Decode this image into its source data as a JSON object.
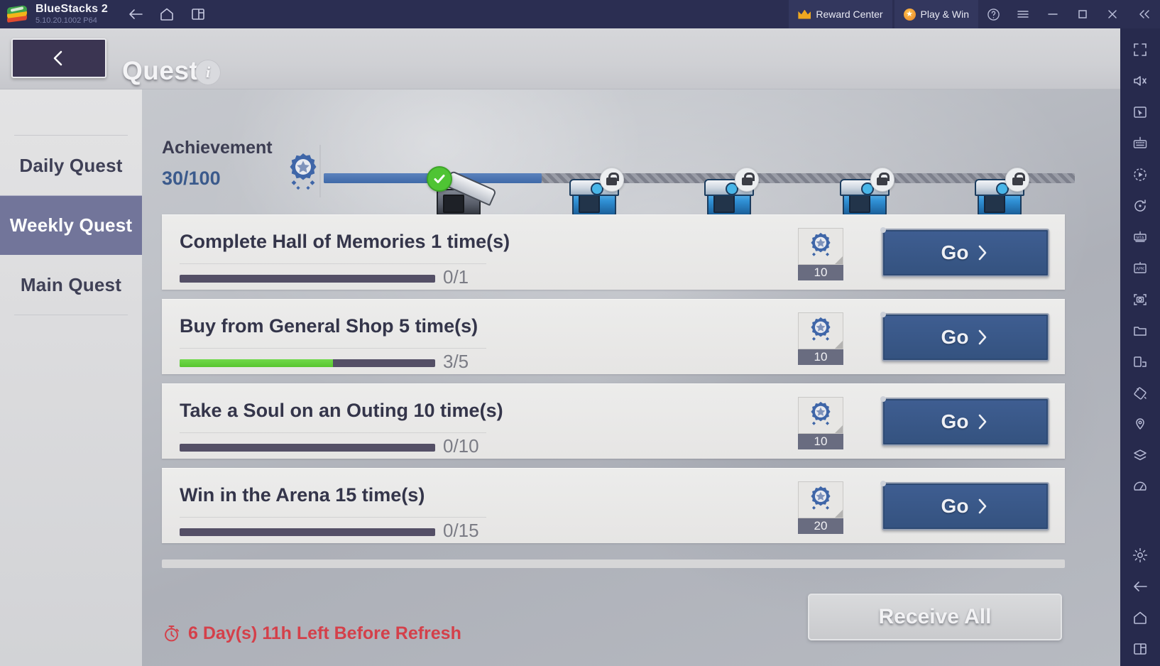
{
  "titlebar": {
    "app_name": "BlueStacks 2",
    "version": "5.10.20.1002  P64",
    "nav": [
      {
        "name": "back-arrow-icon",
        "label": "Back"
      },
      {
        "name": "home-icon",
        "label": "Home"
      },
      {
        "name": "multi-instance-icon",
        "label": "Instances"
      }
    ],
    "reward_center": "Reward Center",
    "play_and_win": "Play & Win",
    "window_buttons": [
      "help-icon",
      "menu-icon",
      "minimize-icon",
      "maximize-icon",
      "close-icon",
      "collapse-icon"
    ]
  },
  "right_toolbar": {
    "icons": [
      "fullscreen-icon",
      "mute-icon",
      "cursor-icon",
      "keyboard-controls-icon",
      "macro-play-icon",
      "rotate-icon",
      "game-controls-icon",
      "apk-install-icon",
      "screenshot-icon",
      "media-folder-icon",
      "multi-instance-sync-icon",
      "tilt-icon",
      "location-icon",
      "layers-icon",
      "performance-meter-icon"
    ],
    "bottom_icons": [
      "settings-gear-icon",
      "android-back-icon",
      "android-home-icon",
      "android-recents-icon"
    ]
  },
  "game": {
    "header": {
      "back_label": "Back",
      "title": "Quest",
      "info_label": "i"
    },
    "quest_tabs": [
      {
        "label": "Daily Quest",
        "active": false
      },
      {
        "label": "Weekly Quest",
        "active": true
      },
      {
        "label": "Main Quest",
        "active": false
      }
    ],
    "achievement": {
      "label": "Achievement",
      "count": "30/100",
      "current": 30,
      "max": 100,
      "fill_percent": 29,
      "milestones": [
        {
          "value": "20",
          "position_percent": 18,
          "state": "claimed"
        },
        {
          "value": "40",
          "position_percent": 36,
          "state": "locked"
        },
        {
          "value": "60",
          "position_percent": 54,
          "state": "locked"
        },
        {
          "value": "80",
          "position_percent": 72,
          "state": "locked"
        },
        {
          "value": "100",
          "position_percent": 90,
          "state": "locked"
        }
      ]
    },
    "quests": [
      {
        "name": "Complete Hall of Memories 1 time(s)",
        "progress_text": "0/1",
        "progress_percent": 0,
        "reward_count": "10",
        "reward_icon": "achievement-medal-icon",
        "action_label": "Go"
      },
      {
        "name": "Buy from General Shop 5 time(s)",
        "progress_text": "3/5",
        "progress_percent": 60,
        "reward_count": "10",
        "reward_icon": "achievement-medal-icon",
        "action_label": "Go"
      },
      {
        "name": "Take a Soul on an Outing 10 time(s)",
        "progress_text": "0/10",
        "progress_percent": 0,
        "reward_count": "10",
        "reward_icon": "achievement-medal-icon",
        "action_label": "Go"
      },
      {
        "name": "Win in the Arena 15 time(s)",
        "progress_text": "0/15",
        "progress_percent": 0,
        "reward_count": "20",
        "reward_icon": "achievement-medal-icon",
        "action_label": "Go"
      }
    ],
    "footer": {
      "timer_text": "6 Day(s) 11h Left Before Refresh",
      "receive_all_label": "Receive All"
    }
  },
  "colors": {
    "bluestacks_bar": "#2b2e52",
    "accent_blue": "#3f69a8",
    "progress_green": "#57c62f",
    "timer_red": "#d4404a",
    "tab_active": "#72759a",
    "go_button": "#34527f"
  }
}
